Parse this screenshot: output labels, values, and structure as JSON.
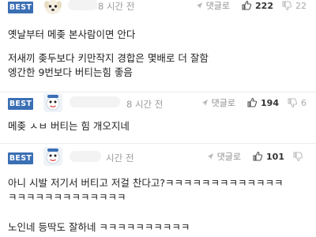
{
  "comments": [
    {
      "badge": "BEST",
      "avatar": "dog-avatar",
      "time": "8 시간 전",
      "reply_label": "댓글로",
      "likes": "222",
      "dislikes": "22",
      "lines": [
        "옛날부터 메좆 본사람이면 안다",
        "저새끼 좆두보다 키만작지 경합은 몇배로 더 잘함",
        "엥간한 9번보다 버티는힘 좋음"
      ]
    },
    {
      "badge": "BEST",
      "avatar": "cartoon-avatar",
      "time": "8 시간 전",
      "reply_label": "댓글로",
      "likes": "194",
      "dislikes": "6",
      "lines": [
        "메좆 ㅅㅂ 버티는 힘 개오지네"
      ]
    },
    {
      "badge": "BEST",
      "avatar": "cartoon-avatar",
      "time": "시간 전",
      "reply_label": "댓글로",
      "likes": "101",
      "dislikes": "",
      "lines": [
        "아니 시발 저기서 버티고 저걸 찬다고?ㅋㅋㅋㅋㅋㅋㅋㅋㅋㅋㅋㅋㅋ",
        "ㅋㅋㅋㅋㅋㅋㅋㅋㅋㅋㅋㅋㅋ",
        "노인네 등딱도 잘하네 ㅋㅋㅋㅋㅋㅋㅋㅋㅋㅋ"
      ]
    }
  ],
  "colors": {
    "best_badge": "#3a6fb4",
    "muted_text": "#9a9a9a"
  }
}
